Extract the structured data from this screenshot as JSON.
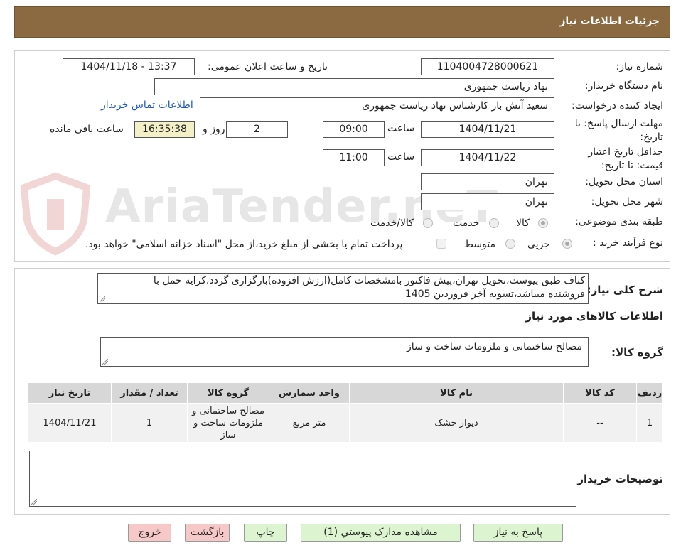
{
  "header": {
    "title": "جزئیات اطلاعات نیاز"
  },
  "watermark": {
    "text": "AriaTender.neT"
  },
  "fields": {
    "need_number": {
      "label": "شماره نیاز:",
      "value": "1104004728000621"
    },
    "announce": {
      "label": "تاریخ و ساعت اعلان عمومی:",
      "value": "1404/11/18 - 13:37"
    },
    "buyer_org": {
      "label": "نام دستگاه خریدار:",
      "value": "نهاد ریاست جمهوری"
    },
    "requester": {
      "label": "ایجاد کننده درخواست:",
      "value": "سعید آتش بار کارشناس نهاد ریاست جمهوری",
      "contact_link": "اطلاعات تماس خریدار"
    },
    "deadline": {
      "label": "مهلت ارسال پاسخ: تا تاریخ:",
      "date": "1404/11/21",
      "time_label": "ساعت",
      "time": "09:00",
      "days": "2",
      "days_label": "روز و",
      "remaining": "16:35:38",
      "remaining_label": "ساعت باقی مانده"
    },
    "validity": {
      "label": "حداقل تاریخ اعتبار قیمت: تا تاریخ:",
      "date": "1404/11/22",
      "time_label": "ساعت",
      "time": "11:00"
    },
    "province": {
      "label": "استان محل تحویل:",
      "value": "تهران"
    },
    "city": {
      "label": "شهر محل تحویل:",
      "value": "تهران"
    },
    "category": {
      "label": "طبقه بندی موضوعی:",
      "options": [
        "کالا",
        "خدمت",
        "کالا/خدمت"
      ],
      "selected": "کالا"
    },
    "process": {
      "label": "نوع فرآیند خرید :",
      "options": [
        "جزیی",
        "متوسط"
      ],
      "selected": "جزیی",
      "note": "پرداخت تمام یا بخشی از مبلغ خرید،از محل \"اسناد خزانه اسلامی\" خواهد بود."
    }
  },
  "description": {
    "label": "شرح کلی نیاز:",
    "line1": "کناف طبق پیوست،تحویل تهران،پیش فاکتور بامشخصات کامل(ارزش افزوده)بارگزاری گردد،کرایه حمل با",
    "line2": "فروشنده میباشد،تسویه آخر فروردین 1405"
  },
  "goods": {
    "section_title": "اطلاعات کالاهای مورد نیاز",
    "group_label": "گروه کالا:",
    "group_value": "مصالح ساختمانی و ملزومات ساخت و ساز",
    "columns": [
      "ردیف",
      "کد کالا",
      "نام کالا",
      "واحد شمارش",
      "گروه کالا",
      "تعداد / مقدار",
      "تاریخ نیاز"
    ],
    "rows": [
      {
        "row": "1",
        "code": "--",
        "name": "دیوار خشک",
        "unit": "متر مربع",
        "group": "مصالح ساختمانی و ملزومات ساخت و ساز",
        "qty": "1",
        "date": "1404/11/21"
      }
    ]
  },
  "buyer_notes": {
    "label": "توضیحات خریدار:",
    "value": ""
  },
  "buttons": {
    "reply": "پاسخ به نیاز",
    "attachments": "مشاهده مدارک پیوستي (1)",
    "print": "چاپ",
    "back": "بازگشت",
    "exit": "خروج"
  },
  "colors": {
    "header_bg": "#8b6a42",
    "link": "#1a55c9",
    "green_btn": "#dcf4cf",
    "pink_btn": "#f7c8c8",
    "remaining_bg": "#f3f0c8"
  }
}
